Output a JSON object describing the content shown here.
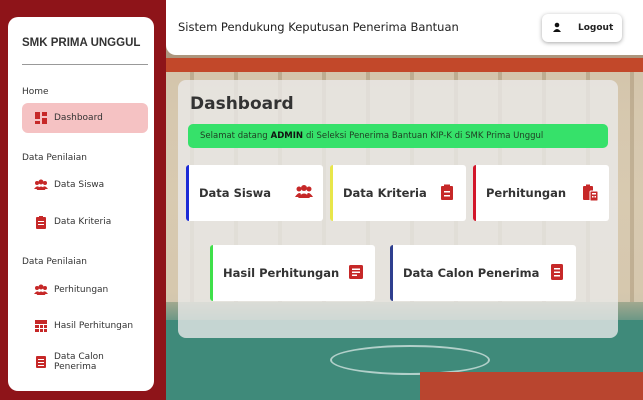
{
  "colors": {
    "brand": "#8e1419",
    "accent_red": "#c62828",
    "welcome_green": "#36e16a",
    "active_nav": "#f5c2c3"
  },
  "sidebar": {
    "brand": "SMK PRIMA UNGGUL",
    "sections": [
      {
        "label": "Home",
        "items": [
          {
            "label": "Dashboard",
            "icon": "dashboard-icon",
            "active": true
          }
        ]
      },
      {
        "label": "Data Penilaian",
        "items": [
          {
            "label": "Data Siswa",
            "icon": "users-icon"
          },
          {
            "label": "Data Kriteria",
            "icon": "clipboard-icon"
          }
        ]
      },
      {
        "label": "Data Penilaian",
        "items": [
          {
            "label": "Perhitungan",
            "icon": "users-icon"
          },
          {
            "label": "Hasil Perhitungan",
            "icon": "table-icon"
          },
          {
            "label": "Data Calon Penerima",
            "icon": "list-icon"
          }
        ]
      }
    ]
  },
  "topbar": {
    "title": "Sistem Pendukung Keputusan Penerima Bantuan",
    "logout_label": "Logout",
    "logout_icon": "user-icon"
  },
  "main": {
    "title": "Dashboard",
    "welcome": {
      "prefix": "Selamat datang",
      "user": "ADMIN",
      "suffix": "di Seleksi Penerima Bantuan KIP-K di SMK Prima Unggul"
    },
    "cards": [
      {
        "label": "Data Siswa",
        "icon": "users-icon",
        "accent": "#1b2bd6"
      },
      {
        "label": "Data Kriteria",
        "icon": "clipboard-icon",
        "accent": "#e8e64a"
      },
      {
        "label": "Perhitungan",
        "icon": "calculator-icon",
        "accent": "#d2162a"
      },
      {
        "label": "Hasil Perhitungan",
        "icon": "checklist-icon",
        "accent": "#3fe04a"
      },
      {
        "label": "Data Calon Penerima",
        "icon": "list-icon",
        "accent": "#2f3f8f"
      }
    ]
  }
}
